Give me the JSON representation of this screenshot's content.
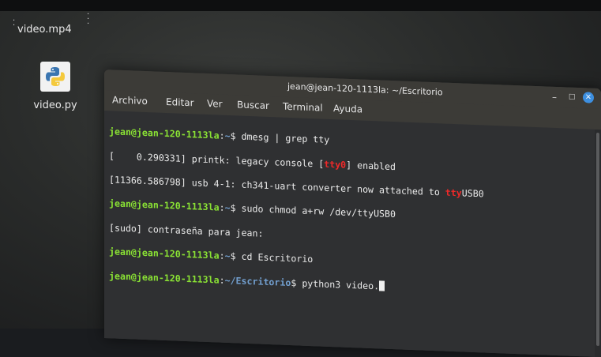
{
  "desktop": {
    "icons": [
      {
        "label": "video.mp4"
      },
      {
        "label": "video.py"
      }
    ]
  },
  "window": {
    "title": "jean@jean-120-1113la: ~/Escritorio",
    "controls": {
      "minimize": "–",
      "maximize": "□",
      "close": "×"
    }
  },
  "menu": [
    "Archivo",
    "Editar",
    "Ver",
    "Buscar",
    "Terminal",
    "Ayuda"
  ],
  "terminal": {
    "line1": {
      "prompt": "jean@jean-120-1113la",
      "path": "~",
      "command": "dmesg | grep tty"
    },
    "line2": {
      "pre": "[    0.290331] printk: legacy console [",
      "hl": "tty0",
      "post": "] enabled"
    },
    "line3": {
      "pre": "[11366.586798] usb 4-1: ch341-uart converter now attached to ",
      "hl": "tty",
      "post": "USB0"
    },
    "line4": {
      "prompt": "jean@jean-120-1113la",
      "path": "~",
      "command": "sudo chmod a+rw /dev/ttyUSB0"
    },
    "line5": {
      "text": "[sudo] contraseña para jean:"
    },
    "line6": {
      "prompt": "jean@jean-120-1113la",
      "path": "~",
      "command": "cd Escritorio"
    },
    "line7": {
      "prompt": "jean@jean-120-1113la",
      "path": "~/Escritorio",
      "command": "python3 video."
    }
  },
  "colors": {
    "prompt_user": "#8ae234",
    "prompt_path": "#729fcf",
    "highlight": "#ef2929",
    "terminal_bg": "#2f3032",
    "close_button": "#3d8fe0"
  }
}
